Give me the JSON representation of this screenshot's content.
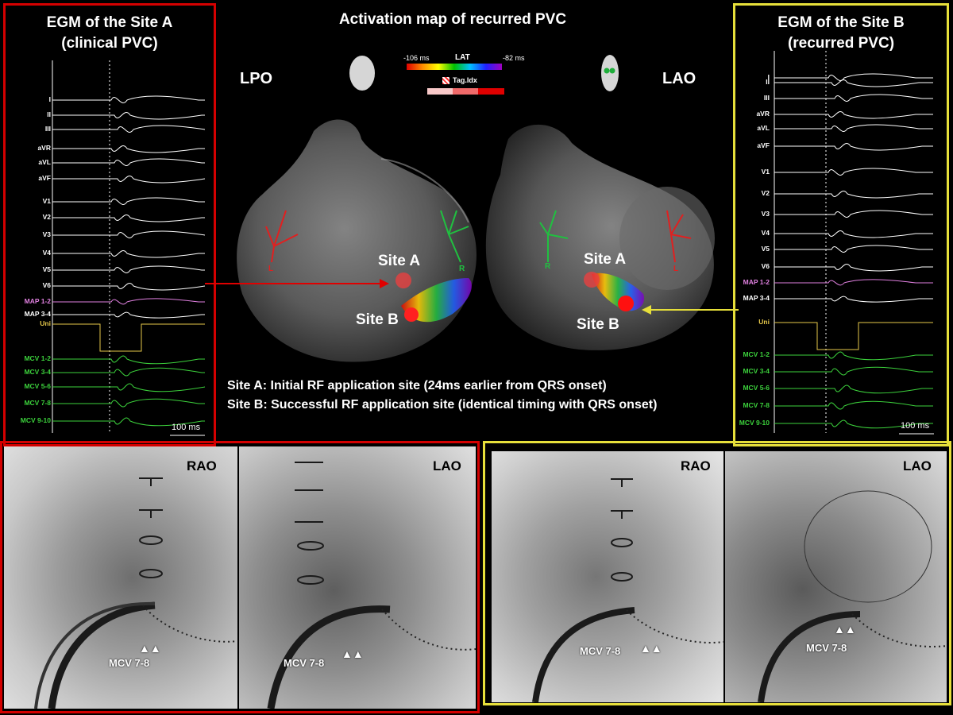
{
  "center": {
    "title": "Activation map of recurred PVC",
    "view_left": "LPO",
    "view_right": "LAO",
    "legend": {
      "min_label": "-106 ms",
      "lat_label": "LAT",
      "max_label": "-82 ms",
      "tag_label": "Tag.Idx"
    },
    "site_a_left": "Site A",
    "site_b_left": "Site B",
    "site_a_right": "Site A",
    "site_b_right": "Site B",
    "axis_L_left": "L",
    "axis_R_left": "R",
    "axis_R_right": "R",
    "axis_L_right": "L",
    "caption_a": "Site A: Initial RF application site (24ms earlier from QRS onset)",
    "caption_b": "Site B: Successful RF application site (identical timing with QRS onset)"
  },
  "egm_a": {
    "title_line1": "EGM of the Site A",
    "title_line2": "(clinical PVC)",
    "channels": [
      "I",
      "II",
      "III",
      "aVR",
      "aVL",
      "aVF",
      "V1",
      "V2",
      "V3",
      "V4",
      "V5",
      "V6",
      "MAP 1-2",
      "MAP 3-4",
      "Uni",
      "MCV 1-2",
      "MCV 3-4",
      "MCV 5-6",
      "MCV 7-8",
      "MCV 9-10"
    ],
    "scale_label": "100 ms"
  },
  "egm_b": {
    "title_line1": "EGM of the Site B",
    "title_line2": "(recurred PVC)",
    "channels": [
      "I",
      "II",
      "III",
      "aVR",
      "aVL",
      "aVF",
      "V1",
      "V2",
      "V3",
      "V4",
      "V5",
      "V6",
      "MAP 1-2",
      "MAP 3-4",
      "Uni",
      "MCV 1-2",
      "MCV 3-4",
      "MCV 5-6",
      "MCV 7-8",
      "MCV 9-10"
    ],
    "scale_label": "100 ms"
  },
  "fluoro_a": {
    "rao_label": "RAO",
    "lao_label": "LAO",
    "mcv_rao": "MCV 7-8",
    "mcv_lao": "MCV 7-8"
  },
  "fluoro_b": {
    "rao_label": "RAO",
    "lao_label": "LAO",
    "mcv_rao": "MCV 7-8",
    "mcv_lao": "MCV 7-8"
  },
  "colors": {
    "red_frame": "#d40000",
    "yellow_frame": "#e6df3a",
    "ecg": "#ffffff",
    "map_channel": "#e080e0",
    "uni_channel": "#e6c84a",
    "mcv_channel": "#3cd23c"
  }
}
